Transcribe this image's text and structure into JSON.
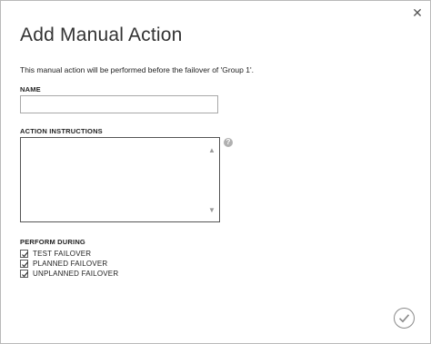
{
  "dialog": {
    "title": "Add Manual Action",
    "description": "This manual action will be performed before the failover of 'Group 1'.",
    "close_icon": "close-icon",
    "confirm_icon": "checkmark-icon"
  },
  "name_field": {
    "label": "NAME",
    "value": ""
  },
  "instructions_field": {
    "label": "ACTION INSTRUCTIONS",
    "value": "",
    "help_icon": "help-icon",
    "help_glyph": "?"
  },
  "perform_during": {
    "label": "PERFORM DURING",
    "options": [
      {
        "label": "TEST FAILOVER",
        "checked": true
      },
      {
        "label": "PLANNED FAILOVER",
        "checked": true
      },
      {
        "label": "UNPLANNED FAILOVER",
        "checked": true
      }
    ]
  }
}
